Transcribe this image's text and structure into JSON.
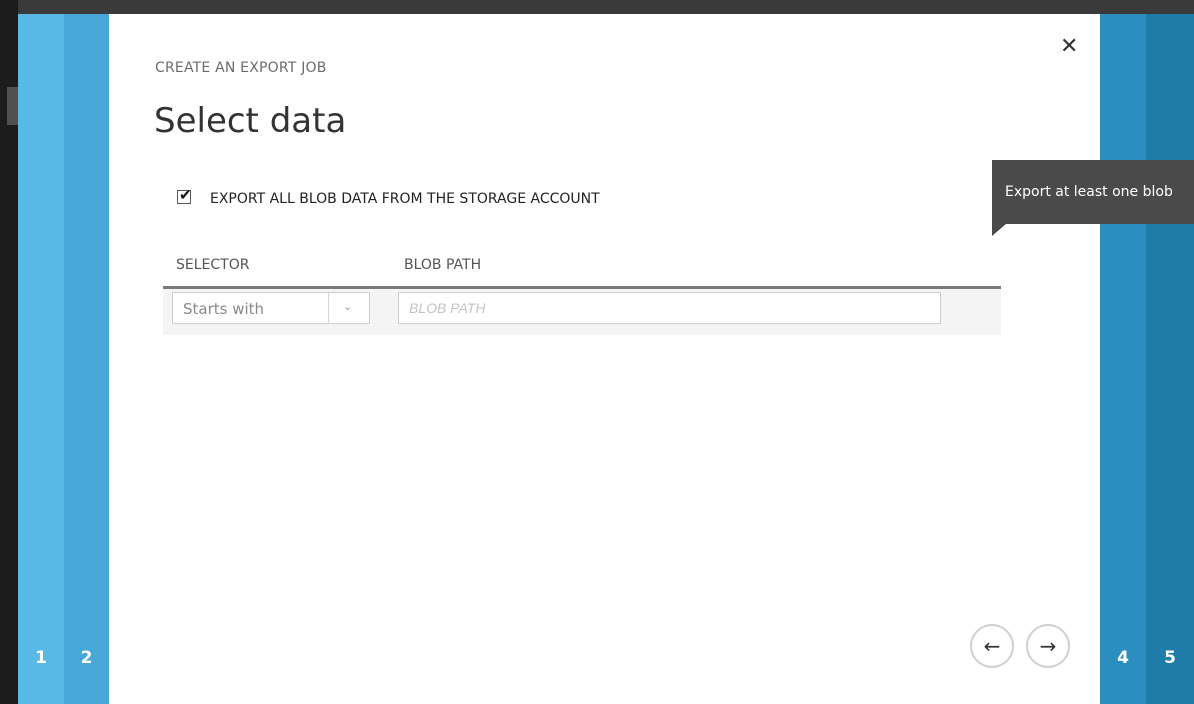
{
  "wizard": {
    "steps_left": [
      "1",
      "2"
    ],
    "steps_right": [
      "4",
      "5"
    ],
    "colors": {
      "step1": "#59b9e6",
      "step2": "#46a7d8",
      "step4": "#2a8fc0",
      "step5": "#1f7ca9"
    }
  },
  "dialog": {
    "subtitle": "CREATE AN EXPORT JOB",
    "title": "Select data",
    "close_icon": "✕",
    "export_all": {
      "checked": true,
      "label": "EXPORT ALL BLOB DATA FROM THE STORAGE ACCOUNT"
    },
    "table": {
      "headers": [
        "SELECTOR",
        "BLOB PATH"
      ],
      "row": {
        "selector_value": "Starts with",
        "blob_path_placeholder": "BLOB PATH",
        "blob_path_value": ""
      }
    },
    "nav": {
      "prev_icon": "←",
      "next_icon": "→"
    }
  },
  "tooltip": {
    "text": "Export at least one blob"
  }
}
